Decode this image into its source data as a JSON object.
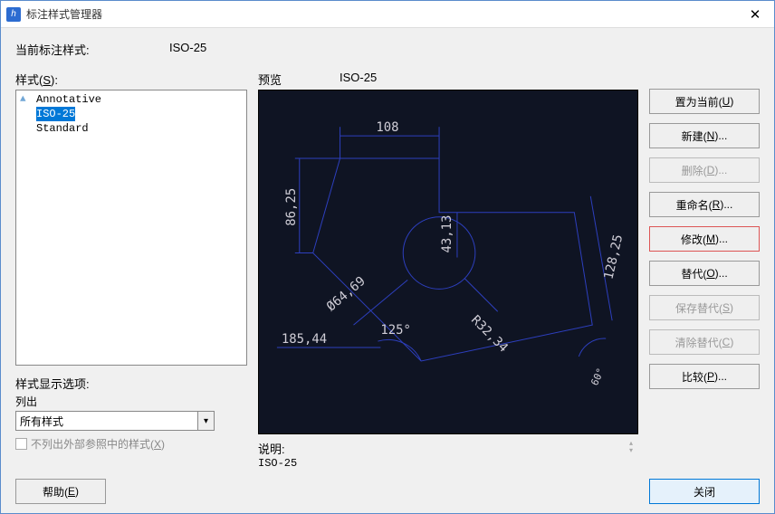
{
  "window": {
    "title": "标注样式管理器"
  },
  "current": {
    "label": "当前标注样式:",
    "value": "ISO-25"
  },
  "stylesLabel": "样式(S):",
  "styles": {
    "items": {
      "0": {
        "label": "Annotative"
      },
      "1": {
        "label": "ISO-25"
      },
      "2": {
        "label": "Standard"
      }
    }
  },
  "displayOptions": {
    "label": "样式显示选项:",
    "sublabel": "列出",
    "comboValue": "所有样式",
    "checkboxLabel": "不列出外部参照中的样式(X)"
  },
  "preview": {
    "label": "预览",
    "styleName": "ISO-25",
    "dims": {
      "top": "108",
      "left": "86,25",
      "mid": "43,13",
      "diag": "Ø64,69",
      "radius": "R32,34",
      "angle": "125°",
      "bottom": "185,44",
      "right": "128,25",
      "tiny": "60°"
    }
  },
  "description": {
    "label": "说明:",
    "value": "ISO-25"
  },
  "buttons": {
    "setCurrent": "置为当前(U)",
    "new": "新建(N)...",
    "delete": "删除(D)...",
    "rename": "重命名(R)...",
    "modify": "修改(M)...",
    "override": "替代(O)...",
    "saveOverride": "保存替代(S)",
    "clearOverride": "清除替代(C)",
    "compare": "比较(P)...",
    "help": "帮助(E)",
    "close": "关闭"
  }
}
